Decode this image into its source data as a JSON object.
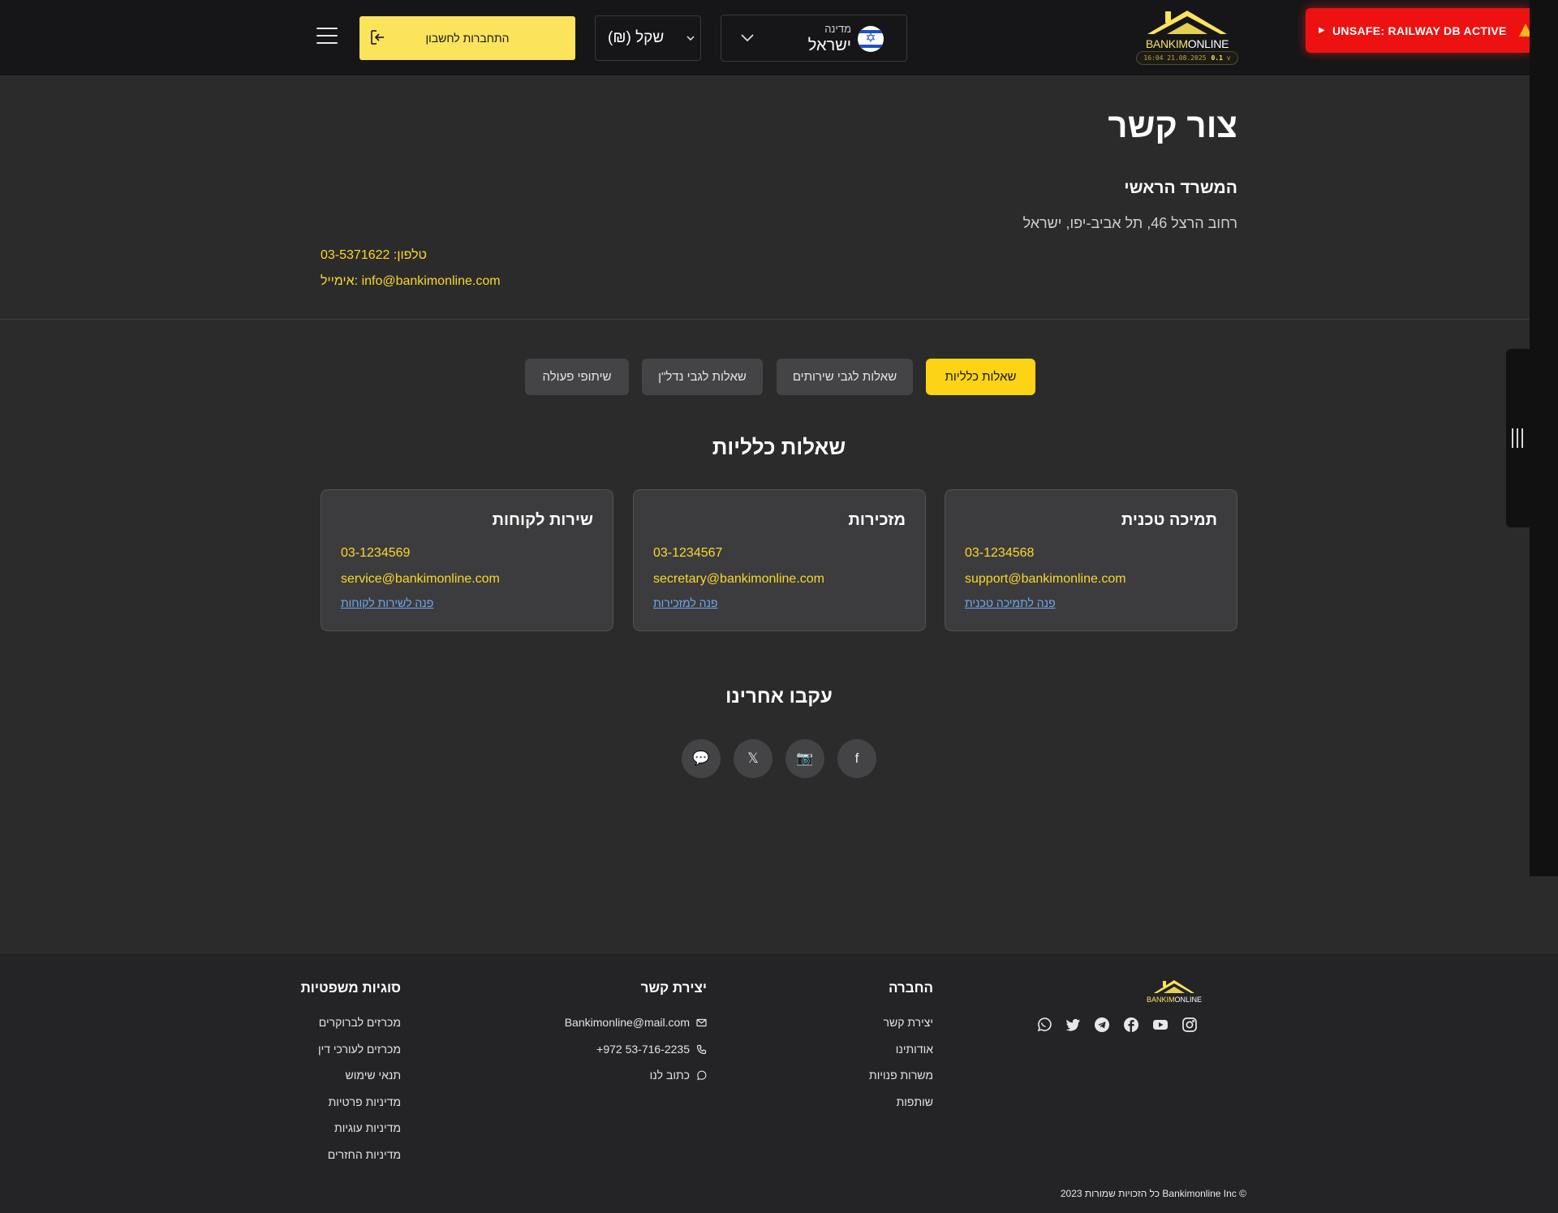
{
  "header": {
    "login_label": "התחברות לחשבון",
    "currency_value": "(₪) שקל",
    "country_label": "מדינה",
    "country_value": "ישראל",
    "flag_icon": "israel-flag-icon",
    "menu_icon": "hamburger-menu-icon",
    "brand": {
      "part1": "BANKIM",
      "part2": "ONLINE",
      "badge_time": "16:04 21.08.2025",
      "badge_version": "0.1",
      "badge_v": "v"
    },
    "warning_banner": "UNSAFE: RAILWAY DB ACTIVE"
  },
  "contact": {
    "title": "צור קשר",
    "office_title": "המשרד הראשי",
    "address": "רחוב הרצל 46, תל אביב-יפו, ישראל",
    "phone": "טלפון: 03-5371622",
    "email": "אימייל: info@bankimonline.com"
  },
  "tabs": [
    {
      "label": "שאלות כלליות",
      "active": true
    },
    {
      "label": "שאלות לגבי שירותים",
      "active": false
    },
    {
      "label": "שאלות לגבי נדל\"ן",
      "active": false
    },
    {
      "label": "שיתופי פעולה",
      "active": false
    }
  ],
  "section_title": "שאלות כלליות",
  "cards": [
    {
      "title": "תמיכה טכנית",
      "phone": "03-1234568",
      "email": "support@bankimonline.com",
      "link": "פנה לתמיכה טכנית"
    },
    {
      "title": "מזכירות",
      "phone": "03-1234567",
      "email": "secretary@bankimonline.com",
      "link": "פנה למזכירות"
    },
    {
      "title": "שירות לקוחות",
      "phone": "03-1234569",
      "email": "service@bankimonline.com",
      "link": "פנה לשירות לקוחות"
    }
  ],
  "follow": {
    "title": "עקבו אחרינו",
    "socials": [
      {
        "icon": "facebook-icon",
        "glyph": "f"
      },
      {
        "icon": "instagram-icon",
        "glyph": "📷"
      },
      {
        "icon": "x-twitter-icon",
        "glyph": "𝕏"
      },
      {
        "icon": "chat-icon",
        "glyph": "💬"
      }
    ]
  },
  "footer": {
    "brand": {
      "part1": "BANKIM",
      "part2": "ONLINE"
    },
    "social_icons": [
      "instagram-icon",
      "youtube-icon",
      "facebook-icon",
      "telegram-icon",
      "twitter-icon",
      "whatsapp-icon"
    ],
    "company": {
      "title": "החברה",
      "items": [
        "יצירת קשר",
        "אודותינו",
        "משרות פנויות",
        "שותפות"
      ]
    },
    "contact": {
      "title": "יצירת קשר",
      "email": "Bankimonline@mail.com",
      "phone": "+972 53-716-2235",
      "write": "כתוב לנו"
    },
    "legal": {
      "title": "סוגיות משפטיות",
      "items": [
        "מכרזים לברוקרים",
        "מכרזים לעורכי דין",
        "תנאי שימוש",
        "מדיניות פרטיות",
        "מדיניות עוגיות",
        "מדיניות החזרים"
      ]
    },
    "copyright": "2023 כל הזכויות שמורות Bankimonline Inc ©"
  },
  "colors": {
    "accent": "#fbd829",
    "button_yellow": "#fbe35c",
    "warning_red": "#ee1111",
    "link_blue": "#6ea9ee"
  }
}
